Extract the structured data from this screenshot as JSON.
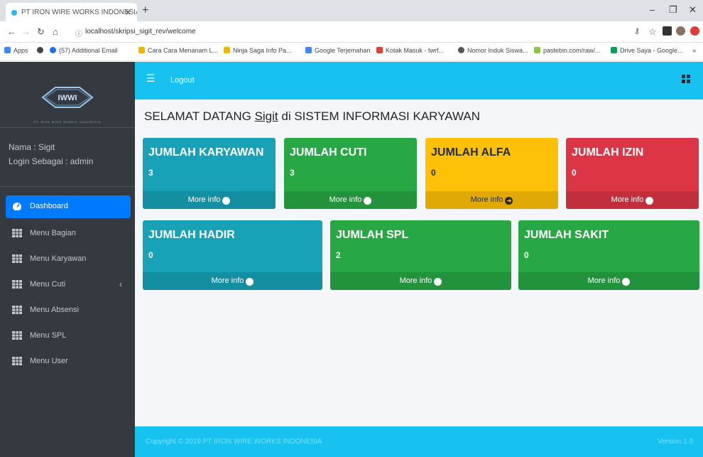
{
  "browser": {
    "tab_title": "PT IRON WIRE WORKS INDONESIA",
    "url": "localhost/skripsi_sigit_rev/welcome",
    "bookmarks": [
      {
        "label": "Apps",
        "color": "#4285f4"
      },
      {
        "label": "",
        "color": "#444444"
      },
      {
        "label": "(57) Additional Email",
        "color": "#1a73e8"
      },
      {
        "label": "Cara Cara Menanam L...",
        "color": "#f4b400"
      },
      {
        "label": "Ninja Saga Info Pa...",
        "color": "#f4b400"
      },
      {
        "label": "Google Terjemahan",
        "color": "#4285f4"
      },
      {
        "label": "Kotak Masuk - twrf...",
        "color": "#db4437"
      },
      {
        "label": "Nomor Induk Siswa...",
        "color": "#555555"
      },
      {
        "label": "pastebin.com/raw/...",
        "color": "#8bc34a"
      },
      {
        "label": "Drive Saya - Google...",
        "color": "#0f9d58"
      }
    ]
  },
  "app": {
    "logo_text": "IWWI",
    "logo_subtext": "PT IRON WIRE WORKS INDONESIA",
    "user_name": "Nama : Sigit",
    "user_role": "Login Sebagai : admin",
    "logout": "Logout",
    "colors": {
      "sidebar": "#343a40",
      "topbar": "#17c1f0",
      "active": "#007bff",
      "teal": "#17a2b8",
      "green": "#28a745",
      "yellow": "#ffc107",
      "red": "#dc3545"
    }
  },
  "sidebar": {
    "items": [
      {
        "label": "Dashboard",
        "icon": "dashboard-icon"
      },
      {
        "label": "Menu Bagian",
        "icon": "table-icon"
      },
      {
        "label": "Menu Karyawan",
        "icon": "table-icon"
      },
      {
        "label": "Menu Cuti",
        "icon": "table-icon"
      },
      {
        "label": "Menu Absensi",
        "icon": "table-icon"
      },
      {
        "label": "Menu SPL",
        "icon": "table-icon"
      },
      {
        "label": "Menu User",
        "icon": "table-icon"
      }
    ]
  },
  "main": {
    "title_prefix": "SELAMAT DATANG",
    "title_user": "Sigit",
    "title_suffix": "di SISTEM INFORMASI KARYAWAN",
    "more_info": "More info",
    "boxes": [
      {
        "title": "JUMLAH KARYAWAN",
        "value": "3",
        "color": "teal"
      },
      {
        "title": "JUMLAH CUTI",
        "value": "3",
        "color": "green"
      },
      {
        "title": "JUMLAH ALFA",
        "value": "0",
        "color": "yellow"
      },
      {
        "title": "JUMLAH IZIN",
        "value": "0",
        "color": "red"
      },
      {
        "title": "JUMLAH HADIR",
        "value": "0",
        "color": "teal"
      },
      {
        "title": "JUMLAH SPL",
        "value": "2",
        "color": "green"
      },
      {
        "title": "JUMLAH SAKIT",
        "value": "0",
        "color": "green"
      }
    ]
  },
  "footer": {
    "left": "Copyright © 2019 PT IRON WIRE WORKS INDONESIA",
    "right": "Version 1.0"
  }
}
